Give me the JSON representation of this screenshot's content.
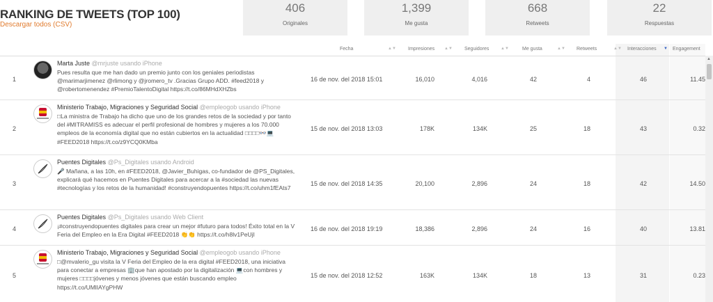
{
  "title": "RANKING DE TWEETS (TOP 100)",
  "download_label": "Descargar todos (CSV)",
  "stats": [
    {
      "value": "406",
      "label": "Originales"
    },
    {
      "value": "1,399",
      "label": "Me gusta"
    },
    {
      "value": "668",
      "label": "Retweets"
    },
    {
      "value": "22",
      "label": "Respuestas"
    }
  ],
  "columns": {
    "fecha": "Fecha",
    "impresiones": "Impresiones",
    "seguidores": "Seguidores",
    "megusta": "Me gusta",
    "retweets": "Retweets",
    "interacciones": "Interacciones",
    "engagement": "Engagement"
  },
  "rows": [
    {
      "num": "1",
      "avatar": "photo-avatar",
      "name": "Marta Juste",
      "meta": "@mrjuste usando iPhone",
      "text": "Pues resulta que me han dado un premio junto con los geniales periodistas @marimarjimenez @rlimong y @jromero_tv .Gracias Grupo ADD. #feed2018 y @robertomenendez #PremioTalentoDigital https://t.co/86MHdXHZbs",
      "fecha": "16 de nov. del 2018 15:01",
      "impresiones": "16,010",
      "seguidores": "4,016",
      "megusta": "42",
      "retweets": "4",
      "interacciones": "46",
      "engagement": "11.45"
    },
    {
      "num": "2",
      "avatar": "ministry-shield-avatar",
      "name": "Ministerio Trabajo, Migraciones y Seguridad Social",
      "meta": "@empleogob usando iPhone",
      "text": "□La ministra de Trabajo ha dicho que uno de los grandes retos de la sociedad y por tanto del #MITRAMISS es adecuar el perfil profesional de hombres y mujeres a los 70.000 empleos de la economía digital que no están cubiertos en la actualidad □□□□👓💻 #FEED2018 https://t.co/z9YCQ0KMba",
      "fecha": "15 de nov. del 2018 13:03",
      "impresiones": "178K",
      "seguidores": "134K",
      "megusta": "25",
      "retweets": "18",
      "interacciones": "43",
      "engagement": "0.32"
    },
    {
      "num": "3",
      "avatar": "feather-avatar",
      "name": "Puentes Digitales",
      "meta": "@Ps_Digitales usando Android",
      "text": "🎤 Mañana, a las 10h, en #FEED2018, @Javier_Buhigas, co-fundador de @PS_Digitales, explicará qué hacemos en Puentes Digitales para acercar a la #sociedad las nuevas #tecnologías y los retos de la humanidad! #construyendopuentes https://t.co/uhm1fEAts7",
      "fecha": "15 de nov. del 2018 14:35",
      "impresiones": "20,100",
      "seguidores": "2,896",
      "megusta": "24",
      "retweets": "18",
      "interacciones": "42",
      "engagement": "14.50"
    },
    {
      "num": "4",
      "avatar": "feather-avatar",
      "name": "Puentes Digitales",
      "meta": "@Ps_Digitales usando Web Client",
      "text": "¡#construyendopuentes digitales para crear un mejor #futuro para todos! Éxito total en la V Feria del Empleo en la Era Digital #FEED2018 👏👏 https://t.co/h8lv1PeUjI",
      "fecha": "16 de nov. del 2018 19:19",
      "impresiones": "18,386",
      "seguidores": "2,896",
      "megusta": "24",
      "retweets": "16",
      "interacciones": "40",
      "engagement": "13.81"
    },
    {
      "num": "5",
      "avatar": "ministry-shield-avatar",
      "name": "Ministerio Trabajo, Migraciones y Seguridad Social",
      "meta": "@empleogob usando iPhone",
      "text": "□@mvalerio_gu visita la V Feria del Empleo de la era digital #FEED2018, una iniciativa para conectar a empresas 🏢que han apostado por la digitalización 💻con hombres y mujeres □□□□jóvenes y menos jóvenes que están buscando empleo https://t.co/UMlIAYgPHW",
      "fecha": "15 de nov. del 2018 12:52",
      "impresiones": "163K",
      "seguidores": "134K",
      "megusta": "18",
      "retweets": "13",
      "interacciones": "31",
      "engagement": "0.23"
    }
  ]
}
